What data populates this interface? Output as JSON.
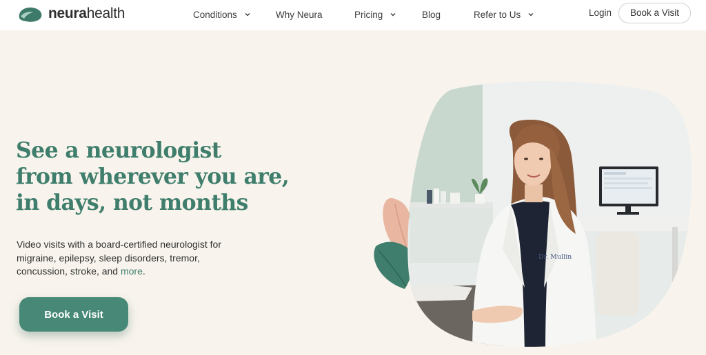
{
  "brand": {
    "name_bold": "neura",
    "name_light": "health",
    "colors": {
      "primary": "#478876",
      "heading": "#3f7e6c",
      "background": "#f8f4ed"
    }
  },
  "nav": {
    "items": [
      {
        "label": "Conditions",
        "has_dropdown": true
      },
      {
        "label": "Why Neura",
        "has_dropdown": false
      },
      {
        "label": "Pricing",
        "has_dropdown": true
      },
      {
        "label": "Blog",
        "has_dropdown": false
      },
      {
        "label": "Refer to Us",
        "has_dropdown": true
      }
    ],
    "login_label": "Login",
    "book_label": "Book a Visit"
  },
  "hero": {
    "headline_lines": [
      "See a neurologist",
      "from wherever you are,",
      "in days, not months"
    ],
    "subcopy": "Video visits with a board-certified neurologist for migraine, epilepsy, sleep disorders, tremor, concussion, stroke, and",
    "subcopy_link": "more",
    "subcopy_end": ".",
    "cta_label": "Book a Visit",
    "coat_badge": "Dr. Mullin"
  },
  "icons": [
    "chevron-down-icon",
    "logo-mark-icon",
    "leaf-icon",
    "monitor-icon",
    "plant-icon"
  ]
}
